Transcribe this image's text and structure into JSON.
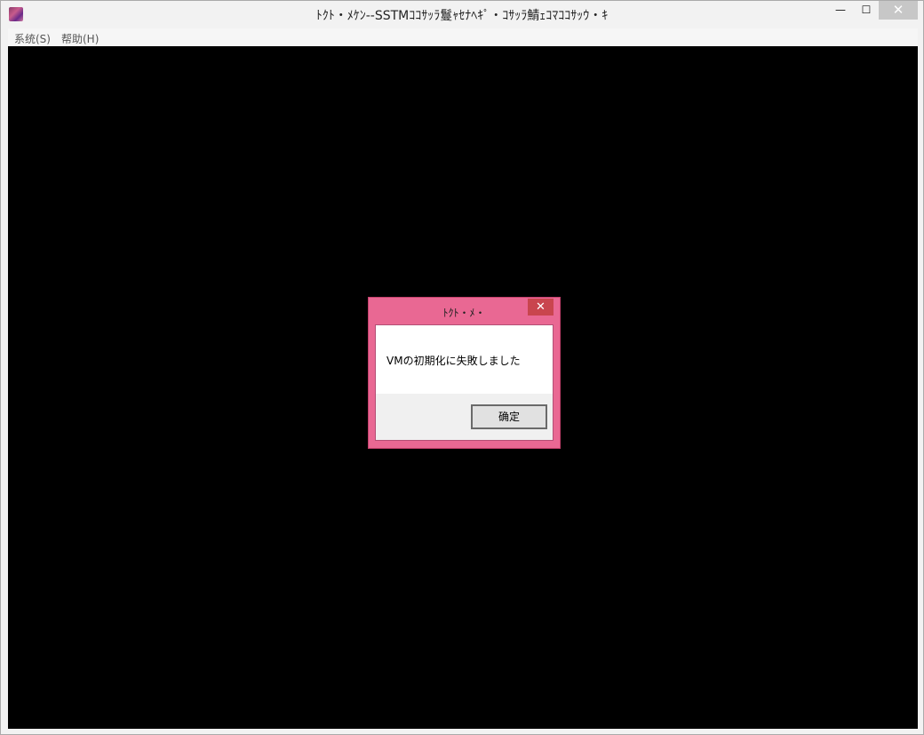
{
  "window": {
    "title": "ﾄｸﾄ・ﾒｹﾝ--SSTMｺｺｻｯﾗ鬘ｬｾﾅﾍｷﾟ・ｺｻｯﾗ鯖ｪｺﾏｺｺｻｯｳ・ｷ",
    "icon": "app-icon",
    "controls": {
      "minimize": "—",
      "maximize": "☐",
      "close": "✕"
    }
  },
  "menubar": {
    "items": [
      {
        "label": "系统(S)"
      },
      {
        "label": "帮助(H)"
      }
    ]
  },
  "dialog": {
    "title": "ﾄｸﾄ・ﾒ・",
    "close_glyph": "✕",
    "message": "VMの初期化に失敗しました",
    "ok_label": "确定"
  },
  "colors": {
    "dialog_frame": "#e96893",
    "dialog_close": "#c9454e",
    "client_bg": "#000000"
  }
}
